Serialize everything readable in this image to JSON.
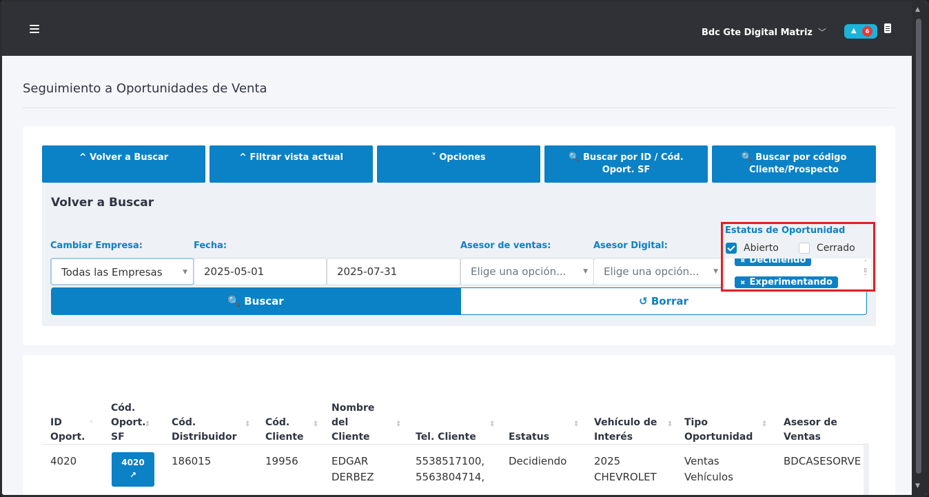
{
  "topbar": {
    "user": "Bdc Gte Digital Matriz",
    "notif_count": "6"
  },
  "page": {
    "title": "Seguimiento a Oportunidades de Venta"
  },
  "toolbar": {
    "volver": "^ Volver a Buscar",
    "filtrar": "^ Filtrar vista actual",
    "opciones": "˅ Opciones",
    "buscar_id": "🔍 Buscar por ID / Cód. Oport. SF",
    "buscar_codigo": "🔍 Buscar por código Cliente/Prospecto"
  },
  "panel": {
    "title": "Volver a Buscar",
    "empresa_label": "Cambiar Empresa:",
    "empresa_value": "Todas las Empresas",
    "fecha_label": "Fecha:",
    "fecha_desde": "2025-05-01",
    "fecha_hasta": "2025-07-31",
    "asesor_ventas_label": "Asesor de ventas:",
    "asesor_ventas_placeholder": "Elige una opción...",
    "asesor_digital_label": "Asesor Digital:",
    "asesor_digital_placeholder": "Elige una opción...",
    "status_label": "Estatus de Oportunidad",
    "abierto": "Abierto",
    "cerrado": "Cerrado",
    "tags": [
      "Decidiendo",
      "Experimentando"
    ],
    "buscar": "Buscar",
    "borrar": "Borrar"
  },
  "table": {
    "headers": [
      "ID Oport.",
      "Cód. Oport. SF",
      "Cód. Distribuidor",
      "Cód. Cliente",
      "Nombre del Cliente",
      "Tel. Cliente",
      "Estatus",
      "Vehículo de Interés",
      "Tipo Oportunidad",
      "Asesor de Ventas"
    ],
    "row": {
      "id": "4020",
      "cod_sf": "4020",
      "distribuidor": "186015",
      "cliente": "19956",
      "nombre": "EDGAR DERBEZ",
      "tel": "5538517100, 5563804714,",
      "estatus": "Decidiendo",
      "vehiculo": "2025 CHEVROLET",
      "tipo": "Ventas Vehículos",
      "asesor": "BDCASESORVE"
    }
  }
}
